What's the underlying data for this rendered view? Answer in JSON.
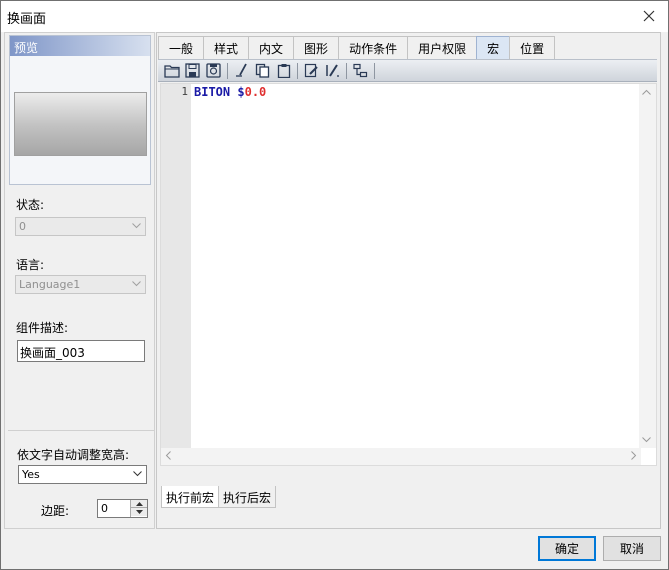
{
  "window": {
    "title": "换画面"
  },
  "left": {
    "preview_label": "预览",
    "state_label": "状态:",
    "state_value": "0",
    "language_label": "语言:",
    "language_value": "Language1",
    "desc_label": "组件描述:",
    "desc_value": "换画面_003",
    "autosize_label": "依文字自动调整宽高:",
    "autosize_value": "Yes",
    "margin_label": "边距:",
    "margin_value": "0"
  },
  "tabs": [
    {
      "label": "一般"
    },
    {
      "label": "样式"
    },
    {
      "label": "内文"
    },
    {
      "label": "图形"
    },
    {
      "label": "动作条件"
    },
    {
      "label": "用户权限"
    },
    {
      "label": "宏",
      "active": true
    },
    {
      "label": "位置"
    }
  ],
  "toolbar": {
    "icons": [
      "open-folder-icon",
      "save-icon",
      "save-as-icon",
      "cut-icon",
      "copy-icon",
      "paste-icon",
      "edit-icon",
      "comment-icon",
      "insert-macro-icon"
    ]
  },
  "editor": {
    "line_number": "1",
    "keyword": "BITON",
    "space": " ",
    "operand": "$0.0"
  },
  "subtabs": [
    {
      "label": "执行前宏",
      "active": true
    },
    {
      "label": "执行后宏"
    }
  ],
  "buttons": {
    "ok": "确定",
    "cancel": "取消"
  },
  "colors": {
    "active_tab": "#dbe6f4",
    "keyword": "#1a1aa6",
    "operand": "#e03030",
    "default_button_border": "#0078d7"
  }
}
